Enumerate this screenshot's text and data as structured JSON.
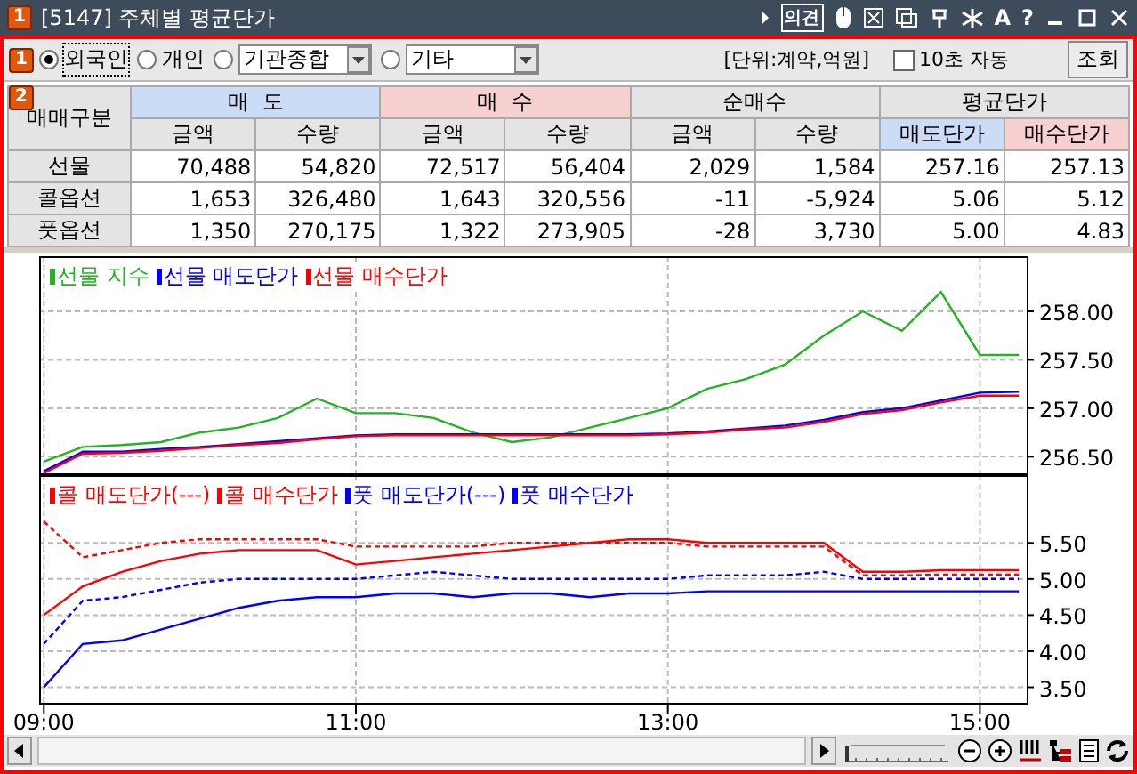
{
  "window": {
    "badge": "1",
    "title": "[5147] 주체별 평균단가",
    "opinion_button": "의견",
    "font_button": "A",
    "help_button": "?"
  },
  "toolbar": {
    "badge": "1",
    "investors": [
      {
        "label": "외국인",
        "selected": true
      },
      {
        "label": "개인",
        "selected": false
      },
      {
        "label": "기관종합",
        "selected": false,
        "kind": "dropdown"
      },
      {
        "label": "기타",
        "selected": false,
        "kind": "dropdown"
      }
    ],
    "unit": "[단위:계약,억원]",
    "auto_refresh": {
      "label": "10초 자동",
      "checked": false
    },
    "query_button": "조회"
  },
  "table": {
    "badge": "2",
    "corner": "매매구분",
    "groups": [
      {
        "label": "매  도",
        "color": "#cadcf6"
      },
      {
        "label": "매  수",
        "color": "#f7d0d0"
      },
      {
        "label": "순매수",
        "color": "#e4e4e4"
      },
      {
        "label": "평균단가",
        "color": "#e4e4e4"
      }
    ],
    "columns": [
      {
        "label": "금액",
        "color": "#e4e4e4"
      },
      {
        "label": "수량",
        "color": "#e4e4e4"
      },
      {
        "label": "금액",
        "color": "#e4e4e4"
      },
      {
        "label": "수량",
        "color": "#e4e4e4"
      },
      {
        "label": "금액",
        "color": "#e4e4e4"
      },
      {
        "label": "수량",
        "color": "#e4e4e4"
      },
      {
        "label": "매도단가",
        "color": "#cadcf6"
      },
      {
        "label": "매수단가",
        "color": "#f7d0d0"
      }
    ],
    "rows": [
      {
        "label": "선물",
        "cells": [
          "70,488",
          "54,820",
          "72,517",
          "56,404",
          "2,029",
          "1,584",
          "257.16",
          "257.13"
        ]
      },
      {
        "label": "콜옵션",
        "cells": [
          "1,653",
          "326,480",
          "1,643",
          "320,556",
          "-11",
          "-5,924",
          "5.06",
          "5.12"
        ]
      },
      {
        "label": "풋옵션",
        "cells": [
          "1,350",
          "270,175",
          "1,322",
          "273,905",
          "-28",
          "3,730",
          "5.00",
          "4.83"
        ]
      }
    ]
  },
  "futures_chart": {
    "chart_data": {
      "type": "line",
      "grid": true,
      "legend": true,
      "categories": [
        null,
        null,
        null,
        null,
        null,
        null,
        null,
        null,
        null,
        null,
        null,
        null,
        null,
        null,
        null,
        null,
        null,
        null,
        null,
        null,
        null,
        null,
        null,
        null,
        null,
        null
      ],
      "ylim": [
        256.31,
        258.57
      ],
      "yticks": [
        {
          "value": 256.5,
          "label": "256.50"
        },
        {
          "value": 257,
          "label": "257.00"
        },
        {
          "value": 257.5,
          "label": "257.50"
        },
        {
          "value": 258,
          "label": "258.00"
        }
      ],
      "series": [
        {
          "name": "선물 지수",
          "color": "#22b422",
          "line_style": "solid",
          "values": [
            256.45,
            256.6,
            256.62,
            256.65,
            256.75,
            256.8,
            256.9,
            257.1,
            256.95,
            256.95,
            256.9,
            256.75,
            256.65,
            256.7,
            256.8,
            256.9,
            257.0,
            257.2,
            257.3,
            257.45,
            257.75,
            258.0,
            257.8,
            258.2,
            257.55,
            257.55
          ]
        },
        {
          "name": "선물 매도단가",
          "color": "#0000ff",
          "line_style": "solid",
          "values": [
            256.35,
            256.55,
            256.55,
            256.58,
            256.6,
            256.63,
            256.66,
            256.69,
            256.72,
            256.73,
            256.73,
            256.73,
            256.73,
            256.73,
            256.73,
            256.73,
            256.74,
            256.76,
            256.79,
            256.82,
            256.88,
            256.96,
            257.0,
            257.08,
            257.16,
            257.17
          ]
        },
        {
          "name": "선물 매수단가",
          "color": "#ff0000",
          "line_style": "solid",
          "values": [
            256.33,
            256.53,
            256.54,
            256.56,
            256.59,
            256.62,
            256.64,
            256.68,
            256.71,
            256.72,
            256.72,
            256.72,
            256.72,
            256.72,
            256.72,
            256.72,
            256.73,
            256.75,
            256.78,
            256.8,
            256.86,
            256.94,
            256.98,
            257.06,
            257.13,
            257.13
          ]
        }
      ]
    }
  },
  "options_chart": {
    "chart_data": {
      "type": "line",
      "grid": true,
      "legend": true,
      "x": [
        9,
        9.25,
        9.5,
        9.75,
        10,
        10.25,
        10.5,
        10.75,
        11,
        11.25,
        11.5,
        11.75,
        12,
        12.25,
        12.5,
        12.75,
        13,
        13.25,
        13.5,
        13.75,
        14,
        14.25,
        14.5,
        14.75,
        15,
        15.25
      ],
      "xlim": [
        8.97,
        15.3
      ],
      "ylim": [
        3.26,
        6.44
      ],
      "xticks": [
        {
          "value": 9,
          "label": "09:00"
        },
        {
          "value": 11,
          "label": "11:00"
        },
        {
          "value": 13,
          "label": "13:00"
        },
        {
          "value": 15,
          "label": "15:00"
        }
      ],
      "yticks": [
        {
          "value": 3.5,
          "label": "3.50"
        },
        {
          "value": 4,
          "label": "4.00"
        },
        {
          "value": 4.5,
          "label": "4.50"
        },
        {
          "value": 5,
          "label": "5.00"
        },
        {
          "value": 5.5,
          "label": "5.50"
        }
      ],
      "series": [
        {
          "name": "콜 매도단가(---)",
          "color": "#ff0000",
          "line_style": "dashed",
          "values": [
            5.8,
            5.3,
            5.4,
            5.5,
            5.55,
            5.55,
            5.55,
            5.55,
            5.45,
            5.45,
            5.45,
            5.45,
            5.5,
            5.5,
            5.5,
            5.5,
            5.5,
            5.45,
            5.45,
            5.45,
            5.45,
            5.05,
            5.05,
            5.06,
            5.06,
            5.06
          ]
        },
        {
          "name": "콜 매수단가",
          "color": "#ff0000",
          "line_style": "solid",
          "values": [
            4.5,
            4.9,
            5.1,
            5.25,
            5.35,
            5.4,
            5.4,
            5.4,
            5.2,
            5.25,
            5.3,
            5.35,
            5.4,
            5.45,
            5.5,
            5.55,
            5.55,
            5.5,
            5.5,
            5.5,
            5.5,
            5.1,
            5.1,
            5.12,
            5.12,
            5.12
          ]
        },
        {
          "name": "풋 매도단가(---)",
          "color": "#0000ff",
          "line_style": "dashed",
          "values": [
            4.1,
            4.7,
            4.75,
            4.85,
            4.95,
            5.0,
            5.0,
            5.0,
            5.0,
            5.05,
            5.1,
            5.05,
            5.0,
            5.0,
            5.0,
            5.0,
            5.0,
            5.05,
            5.05,
            5.05,
            5.1,
            5.0,
            5.0,
            5.0,
            5.0,
            5.0
          ]
        },
        {
          "name": "풋 매수단가",
          "color": "#0000ff",
          "line_style": "solid",
          "values": [
            3.5,
            4.1,
            4.15,
            4.3,
            4.45,
            4.6,
            4.7,
            4.75,
            4.75,
            4.8,
            4.8,
            4.75,
            4.8,
            4.8,
            4.75,
            4.8,
            4.8,
            4.83,
            4.83,
            4.83,
            4.83,
            4.83,
            4.83,
            4.83,
            4.83,
            4.83
          ]
        }
      ]
    }
  }
}
